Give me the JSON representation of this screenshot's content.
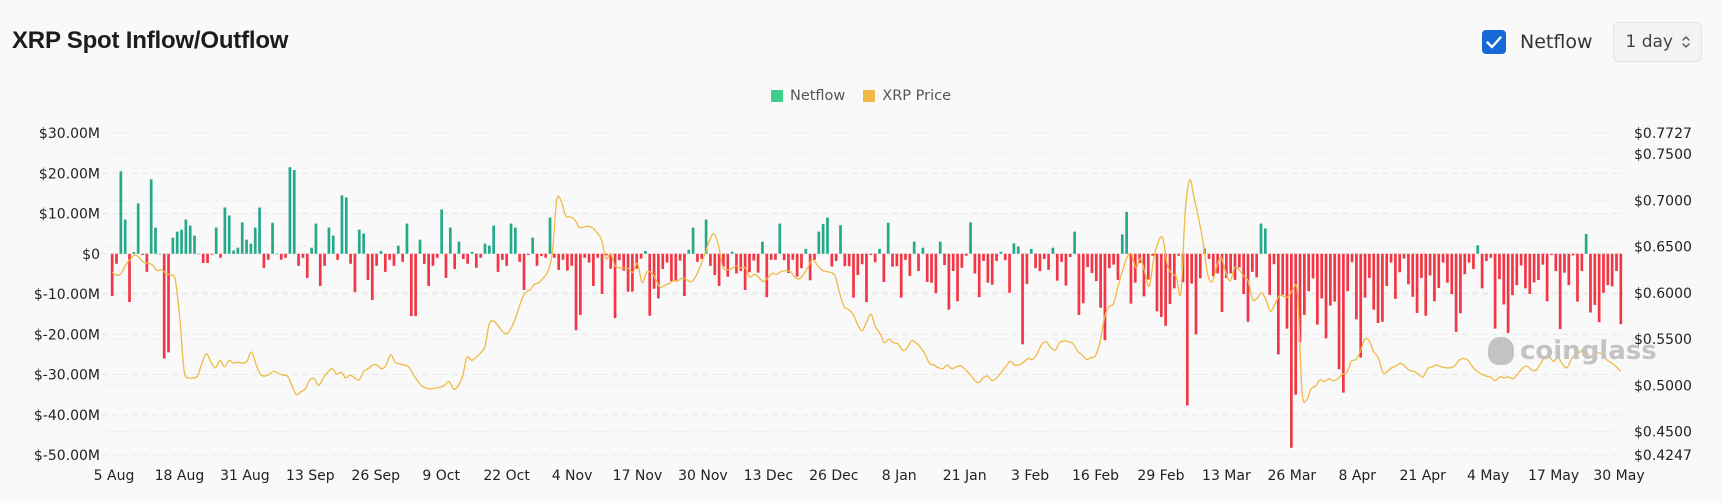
{
  "header": {
    "title": "XRP Spot Inflow/Outflow",
    "netflow_checkbox": {
      "label": "Netflow",
      "checked": true
    },
    "interval_select": {
      "value": "1 day"
    }
  },
  "colors": {
    "inflow": "#26a88a",
    "outflow": "#f23645",
    "price": "#efba45",
    "legend_netflow": "#3ecf8e",
    "legend_price": "#efba45",
    "checkbox": "#1668d6"
  },
  "watermark": "coinglass",
  "chart_data": {
    "type": "bar",
    "title": "XRP Spot Inflow/Outflow",
    "legend": [
      "Netflow",
      "XRP Price"
    ],
    "legend_position": "top-center",
    "grid": true,
    "x_ticks": [
      "5 Aug",
      "18 Aug",
      "31 Aug",
      "13 Sep",
      "26 Sep",
      "9 Oct",
      "22 Oct",
      "4 Nov",
      "17 Nov",
      "30 Nov",
      "13 Dec",
      "26 Dec",
      "8 Jan",
      "21 Jan",
      "3 Feb",
      "16 Feb",
      "29 Feb",
      "13 Mar",
      "26 Mar",
      "8 Apr",
      "21 Apr",
      "4 May",
      "17 May",
      "30 May"
    ],
    "y_left": {
      "label": "Netflow",
      "ticks": [
        "$30.00M",
        "$20.00M",
        "$10.00M",
        "$0",
        "$-10.00M",
        "$-20.00M",
        "$-30.00M",
        "$-40.00M",
        "$-50.00M"
      ],
      "tick_values": [
        30,
        20,
        10,
        0,
        -10,
        -20,
        -30,
        -40,
        -50
      ],
      "range": [
        -50,
        30
      ],
      "unit": "USD millions"
    },
    "y_right": {
      "label": "XRP Price",
      "ticks": [
        "$0.7727",
        "$0.7500",
        "$0.7000",
        "$0.6500",
        "$0.6000",
        "$0.5500",
        "$0.5000",
        "$0.4500",
        "$0.4247"
      ],
      "tick_values": [
        0.7727,
        0.75,
        0.7,
        0.65,
        0.6,
        0.55,
        0.5,
        0.45,
        0.4247
      ],
      "range": [
        0.4247,
        0.7727
      ]
    },
    "series": [
      {
        "name": "Netflow",
        "type": "bar",
        "values": [
          -10.5,
          -2.5,
          20.5,
          8.5,
          -12,
          0.4,
          12.5,
          -0.3,
          -4.5,
          18.5,
          6.5,
          0,
          -26,
          -24.5,
          4,
          5.5,
          6,
          8.5,
          7,
          4.5,
          0,
          -2.3,
          -2.3,
          -0.2,
          6.5,
          -1,
          11.5,
          9.5,
          0.8,
          1.5,
          7.8,
          3.5,
          2.5,
          6.5,
          11.5,
          -3.5,
          -1.5,
          7.7,
          0,
          -1.5,
          -1,
          21.5,
          20.8,
          -3,
          -1,
          -6,
          1.5,
          7.5,
          -8,
          -3,
          6.5,
          4.5,
          -1.5,
          14.5,
          14,
          -2.5,
          -9.5,
          6,
          5,
          -6.5,
          -11.5,
          -3,
          0.7,
          -4.5,
          -1.5,
          -3,
          2,
          -2,
          7.5,
          -15.5,
          -15.5,
          3.5,
          -2.5,
          -8,
          -3,
          -1,
          11,
          -6,
          6.5,
          -3.8,
          3,
          -1.3,
          -2.5,
          0.5,
          -3.5,
          -1,
          2.5,
          2,
          7,
          -4.5,
          -1.5,
          -3,
          7.5,
          6.5,
          -2,
          -9,
          -0.3,
          4,
          -3,
          -0.6,
          -1,
          9,
          -1,
          -4,
          -1.5,
          -4.2,
          -3,
          -19,
          -15.2,
          -1,
          -2.2,
          -8,
          -1,
          -10,
          -0.4,
          -3.7,
          -16,
          -1.6,
          -4.2,
          -9.4,
          -9.4,
          -3.7,
          -1.2,
          0.7,
          -15.4,
          -8.7,
          -11.1,
          -3.8,
          -2.2,
          -6.8,
          -6.9,
          -1.7,
          -10.5,
          1,
          6.5,
          -2,
          -1.3,
          8.5,
          -3,
          -5.3,
          -8,
          -3.2,
          -5.7,
          0.5,
          -4.9,
          -4.3,
          -9,
          -4.6,
          -1.7,
          -4.7,
          3,
          -10.8,
          -1.5,
          -1.5,
          7.5,
          -1.6,
          -4.8,
          -1.5,
          -5.7,
          -3.6,
          1.2,
          -6.6,
          -1.5,
          5.5,
          7.4,
          9,
          -3.2,
          -1.8,
          7.1,
          -3.1,
          -3.1,
          -10.9,
          -5.3,
          -2.6,
          -12,
          -0.3,
          -2.1,
          1.2,
          -7,
          7.7,
          -3.2,
          -3.1,
          -10.9,
          -1.5,
          -5.5,
          3,
          -4.3,
          1.5,
          -7,
          -7.2,
          -9.8,
          3,
          -2.8,
          -13.9,
          -4.3,
          -11.8,
          -3.5,
          -0.5,
          7.8,
          -4.9,
          -10.8,
          -1.8,
          -7.2,
          -7.7,
          -1.8,
          0.5,
          -1.6,
          -9.7,
          2.6,
          1.8,
          -22.5,
          -7.5,
          1.2,
          -3.6,
          -4.3,
          -1.3,
          -4,
          1.5,
          -6.7,
          -2,
          -7.9,
          -0.8,
          5.5,
          -15.2,
          -12.3,
          -3.3,
          -4.8,
          -6.8,
          -13.4,
          -21.5,
          -3.6,
          -2.7,
          -6.5,
          4.8,
          10.4,
          -12.4,
          -7.2,
          -2.3,
          -10.6,
          -6.4,
          -0.5,
          -14.3,
          -15.7,
          -17.9,
          -12.5,
          -8.6,
          -0.5,
          -7.1,
          -37.7,
          -7.4,
          -20,
          -6.1,
          1.3,
          -1.3,
          -5.6,
          -4.9,
          -14.5,
          -6,
          -4.9,
          -6.5,
          -3.4,
          -10,
          -16.9,
          -4.5,
          -5.9,
          7.5,
          6.3,
          -10.2,
          -2.6,
          -25,
          -10.2,
          -18.6,
          -48.2,
          -35,
          -22,
          -15.2,
          -9.3,
          -6.1,
          -17.6,
          -11.1,
          -21,
          -12.9,
          -11.9,
          -28.7,
          -34.5,
          -9.3,
          -2.1,
          -16.3,
          -25.8,
          -10.9,
          -6,
          -13.9,
          -17.2,
          -16.9,
          -8,
          -2.2,
          -11.2,
          -4.6,
          -1.2,
          -7.6,
          -10.7,
          -14.7,
          -6,
          -15.4,
          -5.4,
          -11.8,
          -8.5,
          -2.2,
          -7.2,
          -10,
          -19.4,
          -14.8,
          -5.1,
          -2.2,
          -3.8,
          2.1,
          -8.6,
          -1.8,
          -1,
          -18.6,
          -6.3,
          -12.6,
          -19.7,
          -10.3,
          -7.8,
          -2.9,
          -8.6,
          -10,
          -7.1,
          -6.5,
          -2.7,
          -11.8,
          -0.3,
          -4.3,
          -18.7,
          -4.7,
          -7.8,
          -0.4,
          -11.9,
          -4.3,
          4.9,
          -14.6,
          -12.7,
          -17,
          -9.7,
          -7.8,
          -8.1,
          -4.3,
          -17.5
        ]
      },
      {
        "name": "XRP Price",
        "type": "line",
        "values": [
          0.622,
          0.619,
          0.621,
          0.63,
          0.636,
          0.641,
          0.638,
          0.633,
          0.632,
          0.63,
          0.624,
          0.625,
          0.621,
          0.619,
          0.615,
          0.575,
          0.516,
          0.508,
          0.508,
          0.51,
          0.524,
          0.534,
          0.525,
          0.519,
          0.527,
          0.52,
          0.527,
          0.524,
          0.525,
          0.524,
          0.526,
          0.536,
          0.523,
          0.512,
          0.51,
          0.512,
          0.515,
          0.513,
          0.511,
          0.51,
          0.5,
          0.49,
          0.493,
          0.496,
          0.506,
          0.507,
          0.5,
          0.508,
          0.514,
          0.518,
          0.512,
          0.514,
          0.508,
          0.511,
          0.508,
          0.506,
          0.515,
          0.518,
          0.522,
          0.522,
          0.518,
          0.522,
          0.533,
          0.525,
          0.523,
          0.522,
          0.52,
          0.512,
          0.505,
          0.499,
          0.497,
          0.496,
          0.497,
          0.498,
          0.5,
          0.504,
          0.496,
          0.499,
          0.509,
          0.53,
          0.527,
          0.53,
          0.535,
          0.542,
          0.567,
          0.569,
          0.564,
          0.558,
          0.556,
          0.563,
          0.575,
          0.59,
          0.6,
          0.603,
          0.609,
          0.611,
          0.616,
          0.623,
          0.642,
          0.7,
          0.699,
          0.683,
          0.682,
          0.679,
          0.671,
          0.671,
          0.672,
          0.67,
          0.665,
          0.657,
          0.637,
          0.642,
          0.629,
          0.627,
          0.627,
          0.626,
          0.622,
          0.632,
          0.611,
          0.622,
          0.622,
          0.615,
          0.606,
          0.608,
          0.61,
          0.613,
          0.613,
          0.616,
          0.614,
          0.612,
          0.618,
          0.629,
          0.642,
          0.656,
          0.664,
          0.652,
          0.628,
          0.625,
          0.626,
          0.629,
          0.627,
          0.627,
          0.617,
          0.62,
          0.617,
          0.612,
          0.616,
          0.621,
          0.62,
          0.623,
          0.624,
          0.623,
          0.617,
          0.615,
          0.62,
          0.628,
          0.636,
          0.63,
          0.625,
          0.623,
          0.622,
          0.618,
          0.6,
          0.585,
          0.582,
          0.577,
          0.566,
          0.559,
          0.568,
          0.577,
          0.563,
          0.556,
          0.546,
          0.55,
          0.546,
          0.545,
          0.538,
          0.54,
          0.548,
          0.546,
          0.541,
          0.534,
          0.524,
          0.522,
          0.519,
          0.518,
          0.522,
          0.518,
          0.52,
          0.521,
          0.517,
          0.512,
          0.506,
          0.503,
          0.508,
          0.51,
          0.505,
          0.508,
          0.514,
          0.52,
          0.526,
          0.522,
          0.522,
          0.525,
          0.529,
          0.528,
          0.534,
          0.544,
          0.547,
          0.541,
          0.538,
          0.546,
          0.548,
          0.547,
          0.545,
          0.537,
          0.533,
          0.528,
          0.53,
          0.532,
          0.547,
          0.573,
          0.585,
          0.588,
          0.606,
          0.623,
          0.638,
          0.642,
          0.627,
          0.637,
          0.622,
          0.607,
          0.637,
          0.655,
          0.659,
          0.63,
          0.621,
          0.617,
          0.6,
          0.689,
          0.722,
          0.702,
          0.68,
          0.654,
          0.62,
          0.612,
          0.628,
          0.638,
          0.622,
          0.613,
          0.627,
          0.625,
          0.618,
          0.613,
          0.593,
          0.594,
          0.6,
          0.592,
          0.58,
          0.588,
          0.597,
          0.596,
          0.596,
          0.603,
          0.6,
          0.494,
          0.484,
          0.496,
          0.499,
          0.506,
          0.504,
          0.507,
          0.505,
          0.507,
          0.512,
          0.514,
          0.526,
          0.528,
          0.537,
          0.55,
          0.548,
          0.536,
          0.53,
          0.514,
          0.515,
          0.519,
          0.521,
          0.524,
          0.52,
          0.516,
          0.515,
          0.512,
          0.509,
          0.518,
          0.52,
          0.522,
          0.52,
          0.519,
          0.519,
          0.521,
          0.527,
          0.529,
          0.527,
          0.52,
          0.515,
          0.512,
          0.51,
          0.509,
          0.505,
          0.509,
          0.508,
          0.509,
          0.507,
          0.512,
          0.518,
          0.521,
          0.517,
          0.516,
          0.522,
          0.53,
          0.531,
          0.526,
          0.53,
          0.523,
          0.519,
          0.528,
          0.535,
          0.536,
          0.54,
          0.531,
          0.531,
          0.535,
          0.533,
          0.527,
          0.524,
          0.52,
          0.515
        ]
      }
    ]
  }
}
